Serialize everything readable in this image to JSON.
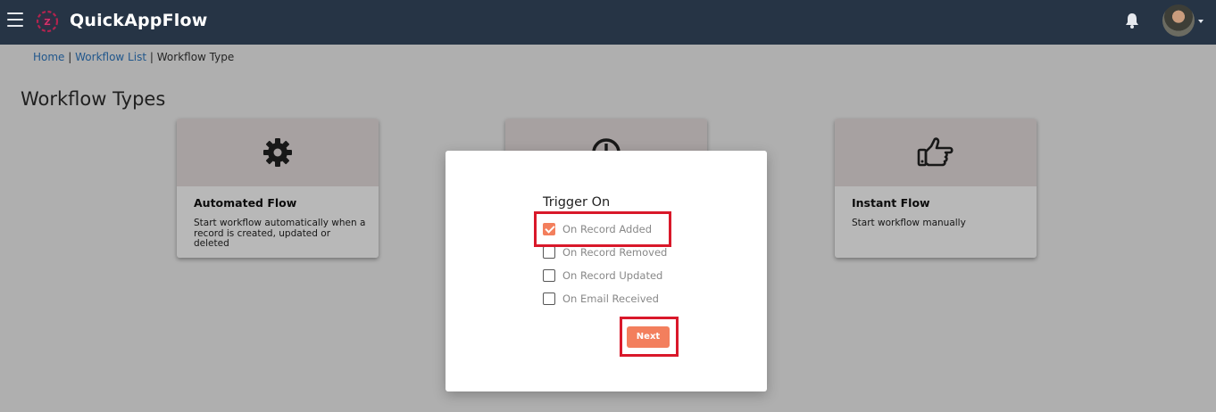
{
  "app": {
    "name": "QuickAppFlow"
  },
  "breadcrumb": {
    "home": "Home",
    "sep": "|",
    "list": "Workflow List",
    "current": "Workflow Type"
  },
  "page": {
    "title": "Workflow Types"
  },
  "cards": [
    {
      "title": "Automated Flow",
      "desc": "Start workflow automatically when a record is created, updated or deleted",
      "icon": "gear-icon"
    },
    {
      "title": "",
      "desc": "",
      "icon": "clock-icon"
    },
    {
      "title": "Instant Flow",
      "desc": "Start workflow manually",
      "icon": "hand-pointer-icon"
    }
  ],
  "modal": {
    "title": "Trigger On",
    "options": [
      {
        "label": "On Record Added",
        "checked": true
      },
      {
        "label": "On Record Removed",
        "checked": false
      },
      {
        "label": "On Record Updated",
        "checked": false
      },
      {
        "label": "On Email Received",
        "checked": false
      }
    ],
    "next_label": "Next"
  },
  "colors": {
    "topbar": "#263445",
    "accent": "#f37f5d",
    "highlight": "#d9182a",
    "link": "#2f79c2"
  }
}
